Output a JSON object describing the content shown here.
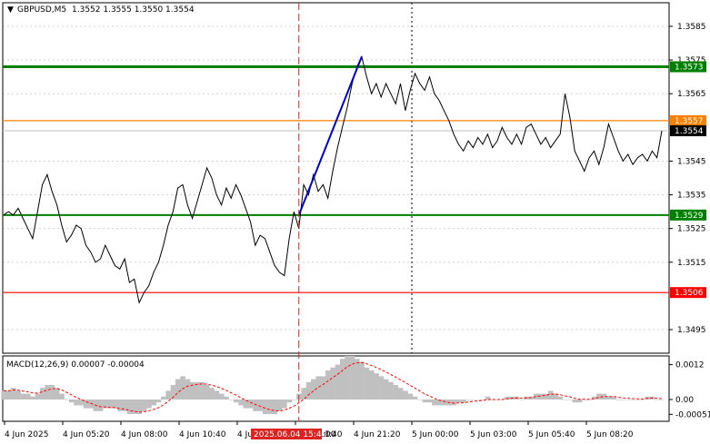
{
  "header": {
    "symbol_tf": "GBPUSD,M5",
    "ohlc": "1.3552 1.3555 1.3550 1.3554"
  },
  "macd_header": "MACD(12,26,9) 0.00007 -0.00004",
  "colors": {
    "support_resistance": "#008000",
    "target": "#ff8000",
    "stop": "#ff0000",
    "trend": "#0000cc",
    "price": "#000000",
    "histogram": "#c0c0c0",
    "signal": "#ff0000",
    "cursor_tag": "#dd2222"
  },
  "chart_data": {
    "type": "line",
    "price_axis": {
      "ticks": [
        "1.3585",
        "1.3575",
        "1.3565",
        "1.3545",
        "1.3535",
        "1.3525",
        "1.3515",
        "1.3495"
      ],
      "range": [
        1.3488,
        1.3592
      ]
    },
    "time_axis": {
      "ticks": [
        "4 Jun 2025",
        "4 Jun 05:20",
        "4 Jun 08:00",
        "4 Jun 10:40",
        "4 Jun 1",
        "4 Jun 18:40",
        "4 Jun 21:20",
        "5 Jun 00:00",
        "5 Jun 03:00",
        "5 Jun 05:40",
        "5 Jun 08:20"
      ]
    },
    "cursor_label": "2025.06.04 15:40",
    "partial_tick": ":00",
    "levels": [
      {
        "value": 1.3573,
        "label": "1.3573",
        "role": "resistance"
      },
      {
        "value": 1.3557,
        "label": "1.3557",
        "role": "target"
      },
      {
        "value": 1.3529,
        "label": "1.3529",
        "role": "support"
      },
      {
        "value": 1.3506,
        "label": "1.3506",
        "role": "stop"
      }
    ],
    "current_price": {
      "value": 1.3554,
      "label": "1.3554"
    },
    "series": [
      {
        "values": [
          1.3529,
          1.353,
          1.3529,
          1.3531,
          1.3528,
          1.3525,
          1.3522,
          1.353,
          1.3538,
          1.3541,
          1.3536,
          1.3532,
          1.3526,
          1.3521,
          1.3523,
          1.3526,
          1.3525,
          1.352,
          1.3518,
          1.3515,
          1.3516,
          1.352,
          1.3517,
          1.3514,
          1.3513,
          1.3516,
          1.3509,
          1.351,
          1.3503,
          1.3506,
          1.3508,
          1.3512,
          1.3515,
          1.352,
          1.3526,
          1.353,
          1.3537,
          1.3538,
          1.3532,
          1.3528,
          1.3533,
          1.3538,
          1.3543,
          1.354,
          1.3535,
          1.3532,
          1.3537,
          1.3534,
          1.3538,
          1.3535,
          1.3531,
          1.3527,
          1.352,
          1.3523,
          1.3522,
          1.3518,
          1.3514,
          1.3512,
          1.3511,
          1.3522,
          1.353,
          1.3525,
          1.3538,
          1.3535,
          1.3541,
          1.3536,
          1.3538,
          1.3534,
          1.3542,
          1.3549,
          1.3555,
          1.3561,
          1.3568,
          1.3573,
          1.3576,
          1.357,
          1.3565,
          1.3568,
          1.3564,
          1.3568,
          1.3565,
          1.3562,
          1.3568,
          1.356,
          1.3566,
          1.3571,
          1.3568,
          1.3566,
          1.357,
          1.3565,
          1.3563,
          1.356,
          1.3557,
          1.3553,
          1.355,
          1.3548,
          1.3551,
          1.3549,
          1.3552,
          1.355,
          1.3553,
          1.3549,
          1.3551,
          1.3555,
          1.3552,
          1.355,
          1.3553,
          1.355,
          1.3555,
          1.3556,
          1.3553,
          1.355,
          1.3552,
          1.3549,
          1.3551,
          1.3553,
          1.3565,
          1.3558,
          1.3548,
          1.3545,
          1.3542,
          1.3546,
          1.3548,
          1.3544,
          1.3549,
          1.3556,
          1.3552,
          1.3548,
          1.3545,
          1.3547,
          1.3544,
          1.3546,
          1.3547,
          1.3545,
          1.3548,
          1.3546,
          1.3554
        ]
      }
    ],
    "trend_line": {
      "from_index": 61,
      "to_index": 74,
      "y_from": 1.3529,
      "y_to": 1.3576
    },
    "macd": {
      "ticks": [
        "0.0012",
        "0.00",
        "-0.00051"
      ],
      "range": [
        -0.00075,
        0.0015
      ],
      "histogram": [
        0.0003,
        0.0003,
        0.0004,
        0.0003,
        0.0002,
        0.0002,
        0.0001,
        0.0002,
        0.0004,
        0.0005,
        0.0005,
        0.0004,
        0.0002,
        0.0,
        -0.0001,
        -0.0002,
        -0.0002,
        -0.0003,
        -0.0003,
        -0.0004,
        -0.0004,
        -0.0003,
        -0.0003,
        -0.0003,
        -0.0004,
        -0.0004,
        -0.0005,
        -0.0005,
        -0.0005,
        -0.0004,
        -0.0003,
        -0.0002,
        -0.0001,
        0.0001,
        0.0003,
        0.0005,
        0.0007,
        0.0008,
        0.0007,
        0.0006,
        0.0006,
        0.0006,
        0.0005,
        0.0004,
        0.0003,
        0.0002,
        0.0001,
        0.0,
        -0.0001,
        -0.0002,
        -0.0003,
        -0.0003,
        -0.0004,
        -0.0004,
        -0.0005,
        -0.0005,
        -0.0005,
        -0.0004,
        -0.0003,
        -0.0001,
        0.0,
        0.0002,
        0.0004,
        0.0006,
        0.0007,
        0.0008,
        0.0008,
        0.001,
        0.0011,
        0.0012,
        0.0014,
        0.0015,
        0.0015,
        0.0014,
        0.0013,
        0.0011,
        0.001,
        0.0009,
        0.0008,
        0.0007,
        0.0006,
        0.0005,
        0.0004,
        0.0003,
        0.0002,
        0.0001,
        0.0,
        -0.0001,
        -0.0001,
        -0.0002,
        -0.0002,
        -0.0002,
        -0.0002,
        -0.0002,
        -0.0001,
        -0.0001,
        0.0,
        0.0,
        0.0,
        0.0,
        0.0001,
        0.0,
        0.0,
        0.0,
        0.0001,
        0.0001,
        0.0001,
        0.0,
        0.0001,
        0.0001,
        0.0002,
        0.0002,
        0.0002,
        0.0003,
        0.0002,
        0.0001,
        0.0,
        0.0,
        -0.0001,
        -0.0001,
        0.0,
        0.0,
        0.0001,
        0.0002,
        0.0002,
        0.0001,
        0.0001,
        0.0,
        0.0,
        0.0,
        0.0,
        0.0,
        0.0,
        0.0001,
        0.0001,
        0.0,
        0.0
      ]
    }
  }
}
